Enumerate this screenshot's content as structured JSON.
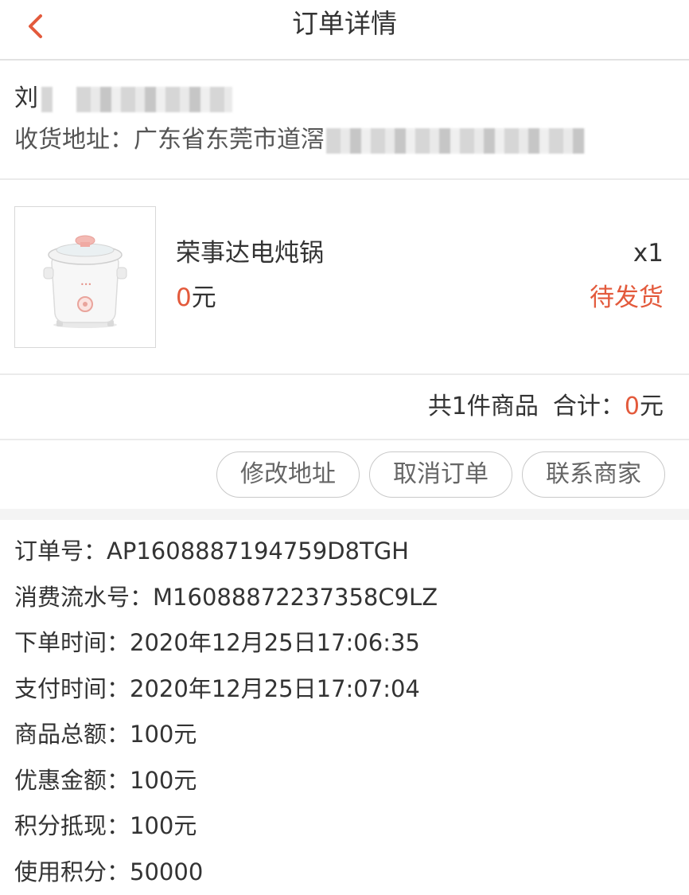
{
  "header": {
    "title": "订单详情",
    "back_icon": "chevron-left-icon",
    "accent": "#e35a3c"
  },
  "address": {
    "name_visible": "刘",
    "address_label": "收货地址：",
    "address_visible": "广东省东莞市道滘"
  },
  "product": {
    "name": "荣事达电炖锅",
    "price_value": "0",
    "price_unit": "元",
    "quantity": "x1",
    "status": "待发货"
  },
  "summary": {
    "count_text": "共1件商品",
    "total_label": "合计：",
    "total_value": "0",
    "total_unit": "元"
  },
  "actions": {
    "modify_address": "修改地址",
    "cancel_order": "取消订单",
    "contact_seller": "联系商家"
  },
  "order_info": [
    {
      "label": "订单号：",
      "value": "AP1608887194759D8TGH"
    },
    {
      "label": "消费流水号：",
      "value": "M16088872237358C9LZ"
    },
    {
      "label": "下单时间：",
      "value": "2020年12月25日17:06:35"
    },
    {
      "label": "支付时间：",
      "value": "2020年12月25日17:07:04"
    },
    {
      "label": "商品总额：",
      "value": "100元"
    },
    {
      "label": "优惠金额：",
      "value": "100元"
    },
    {
      "label": "积分抵现：",
      "value": "100元"
    },
    {
      "label": "使用积分：",
      "value": "50000"
    }
  ]
}
